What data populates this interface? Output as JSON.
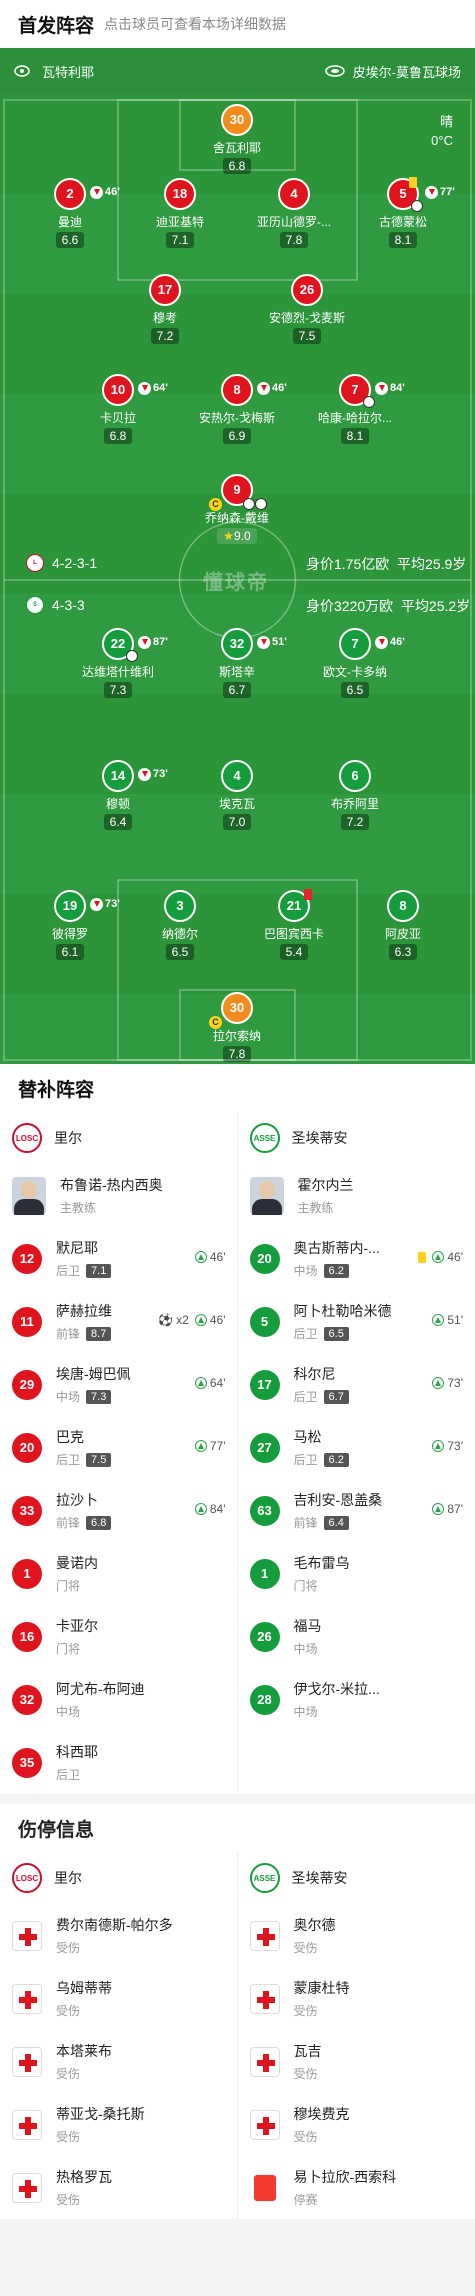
{
  "lineup": {
    "title": "首发阵容",
    "hint": "点击球员可查看本场详细数据",
    "home_team": "瓦特利耶",
    "venue": "皮埃尔-莫鲁瓦球场",
    "weather": "晴",
    "temperature": "0°C",
    "watermark": "懂球帝",
    "home_formation": "4-2-3-1",
    "home_value": "身价1.75亿欧",
    "home_age": "平均25.9岁",
    "away_formation": "4-3-3",
    "away_value": "身价3220万欧",
    "away_age": "平均25.2岁",
    "colors": {
      "home": "#e0141e",
      "away": "#159c3c",
      "gk": "#f28c1c",
      "pitch": "#2f9a3f"
    }
  },
  "home_players": [
    {
      "num": "30",
      "name": "舍瓦利耶",
      "rating": "6.8"
    },
    {
      "num": "2",
      "name": "曼迪",
      "rating": "6.6",
      "sub": "46'"
    },
    {
      "num": "18",
      "name": "迪亚基特",
      "rating": "7.1"
    },
    {
      "num": "4",
      "name": "亚历山德罗-...",
      "rating": "7.8"
    },
    {
      "num": "5",
      "name": "古德蒙松",
      "rating": "8.1",
      "sub": "77'"
    },
    {
      "num": "17",
      "name": "穆考",
      "rating": "7.2"
    },
    {
      "num": "26",
      "name": "安德烈-戈麦斯",
      "rating": "7.5"
    },
    {
      "num": "10",
      "name": "卡贝拉",
      "rating": "6.8",
      "sub": "64'"
    },
    {
      "num": "8",
      "name": "安热尔-戈梅斯",
      "rating": "6.9",
      "sub": "46'"
    },
    {
      "num": "7",
      "name": "哈康-哈拉尔...",
      "rating": "8.1",
      "sub": "84'"
    },
    {
      "num": "9",
      "name": "乔纳森-戴维",
      "rating": "9.0"
    }
  ],
  "away_players": [
    {
      "num": "22",
      "name": "达维塔什维利",
      "rating": "7.3",
      "sub": "87'"
    },
    {
      "num": "32",
      "name": "斯塔辛",
      "rating": "6.7",
      "sub": "51'"
    },
    {
      "num": "7",
      "name": "欧文-卡多纳",
      "rating": "6.5",
      "sub": "46'"
    },
    {
      "num": "14",
      "name": "穆顿",
      "rating": "6.4",
      "sub": "73'"
    },
    {
      "num": "4",
      "name": "埃克瓦",
      "rating": "7.0"
    },
    {
      "num": "6",
      "name": "布乔阿里",
      "rating": "7.2"
    },
    {
      "num": "19",
      "name": "彼得罗",
      "rating": "6.1",
      "sub": "73'"
    },
    {
      "num": "3",
      "name": "纳德尔",
      "rating": "6.5"
    },
    {
      "num": "21",
      "name": "巴图宾西卡",
      "rating": "5.4"
    },
    {
      "num": "8",
      "name": "阿皮亚",
      "rating": "6.3"
    },
    {
      "num": "30",
      "name": "拉尔索纳",
      "rating": "7.8"
    }
  ],
  "subs": {
    "title": "替补阵容",
    "home_team": "里尔",
    "away_team": "圣埃蒂安",
    "home_coach": {
      "name": "布鲁诺-热内西奥",
      "role": "主教练"
    },
    "away_coach": {
      "name": "霍尔内兰",
      "role": "主教练"
    },
    "home": [
      {
        "num": "12",
        "name": "默尼耶",
        "pos": "后卫",
        "rating": "7.1",
        "in": "46'"
      },
      {
        "num": "11",
        "name": "萨赫拉维",
        "pos": "前锋",
        "rating": "8.7",
        "in": "46'",
        "goals": "x2"
      },
      {
        "num": "29",
        "name": "埃唐-姆巴佩",
        "pos": "中场",
        "rating": "7.3",
        "in": "64'"
      },
      {
        "num": "20",
        "name": "巴克",
        "pos": "后卫",
        "rating": "7.5",
        "in": "77'"
      },
      {
        "num": "33",
        "name": "拉沙卜",
        "pos": "前锋",
        "rating": "6.8",
        "in": "84'"
      },
      {
        "num": "1",
        "name": "曼诺内",
        "pos": "门将"
      },
      {
        "num": "16",
        "name": "卡亚尔",
        "pos": "门将"
      },
      {
        "num": "32",
        "name": "阿尤布-布阿迪",
        "pos": "中场"
      },
      {
        "num": "35",
        "name": "科西耶",
        "pos": "后卫"
      }
    ],
    "away": [
      {
        "num": "20",
        "name": "奥古斯蒂内-...",
        "pos": "中场",
        "rating": "6.2",
        "in": "46'",
        "yellow": true
      },
      {
        "num": "5",
        "name": "阿卜杜勒哈米德",
        "pos": "后卫",
        "rating": "6.5",
        "in": "51'"
      },
      {
        "num": "17",
        "name": "科尔尼",
        "pos": "后卫",
        "rating": "6.7",
        "in": "73'"
      },
      {
        "num": "27",
        "name": "马松",
        "pos": "后卫",
        "rating": "6.2",
        "in": "73'"
      },
      {
        "num": "63",
        "name": "吉利安-恩盖桑",
        "pos": "前锋",
        "rating": "6.4",
        "in": "87'"
      },
      {
        "num": "1",
        "name": "毛布雷乌",
        "pos": "门将"
      },
      {
        "num": "26",
        "name": "福马",
        "pos": "中场"
      },
      {
        "num": "28",
        "name": "伊戈尔-米拉...",
        "pos": "中场"
      }
    ]
  },
  "injuries": {
    "title": "伤停信息",
    "home_team": "里尔",
    "away_team": "圣埃蒂安",
    "home": [
      {
        "name": "费尔南德斯-帕尔多",
        "status": "受伤"
      },
      {
        "name": "乌姆蒂蒂",
        "status": "受伤"
      },
      {
        "name": "本塔莱布",
        "status": "受伤"
      },
      {
        "name": "蒂亚戈-桑托斯",
        "status": "受伤"
      },
      {
        "name": "热格罗瓦",
        "status": "受伤"
      }
    ],
    "away": [
      {
        "name": "奥尔德",
        "status": "受伤"
      },
      {
        "name": "蒙康杜特",
        "status": "受伤"
      },
      {
        "name": "瓦吉",
        "status": "受伤"
      },
      {
        "name": "穆埃费克",
        "status": "受伤"
      },
      {
        "name": "易卜拉欣-西索科",
        "status": "停赛"
      }
    ]
  }
}
